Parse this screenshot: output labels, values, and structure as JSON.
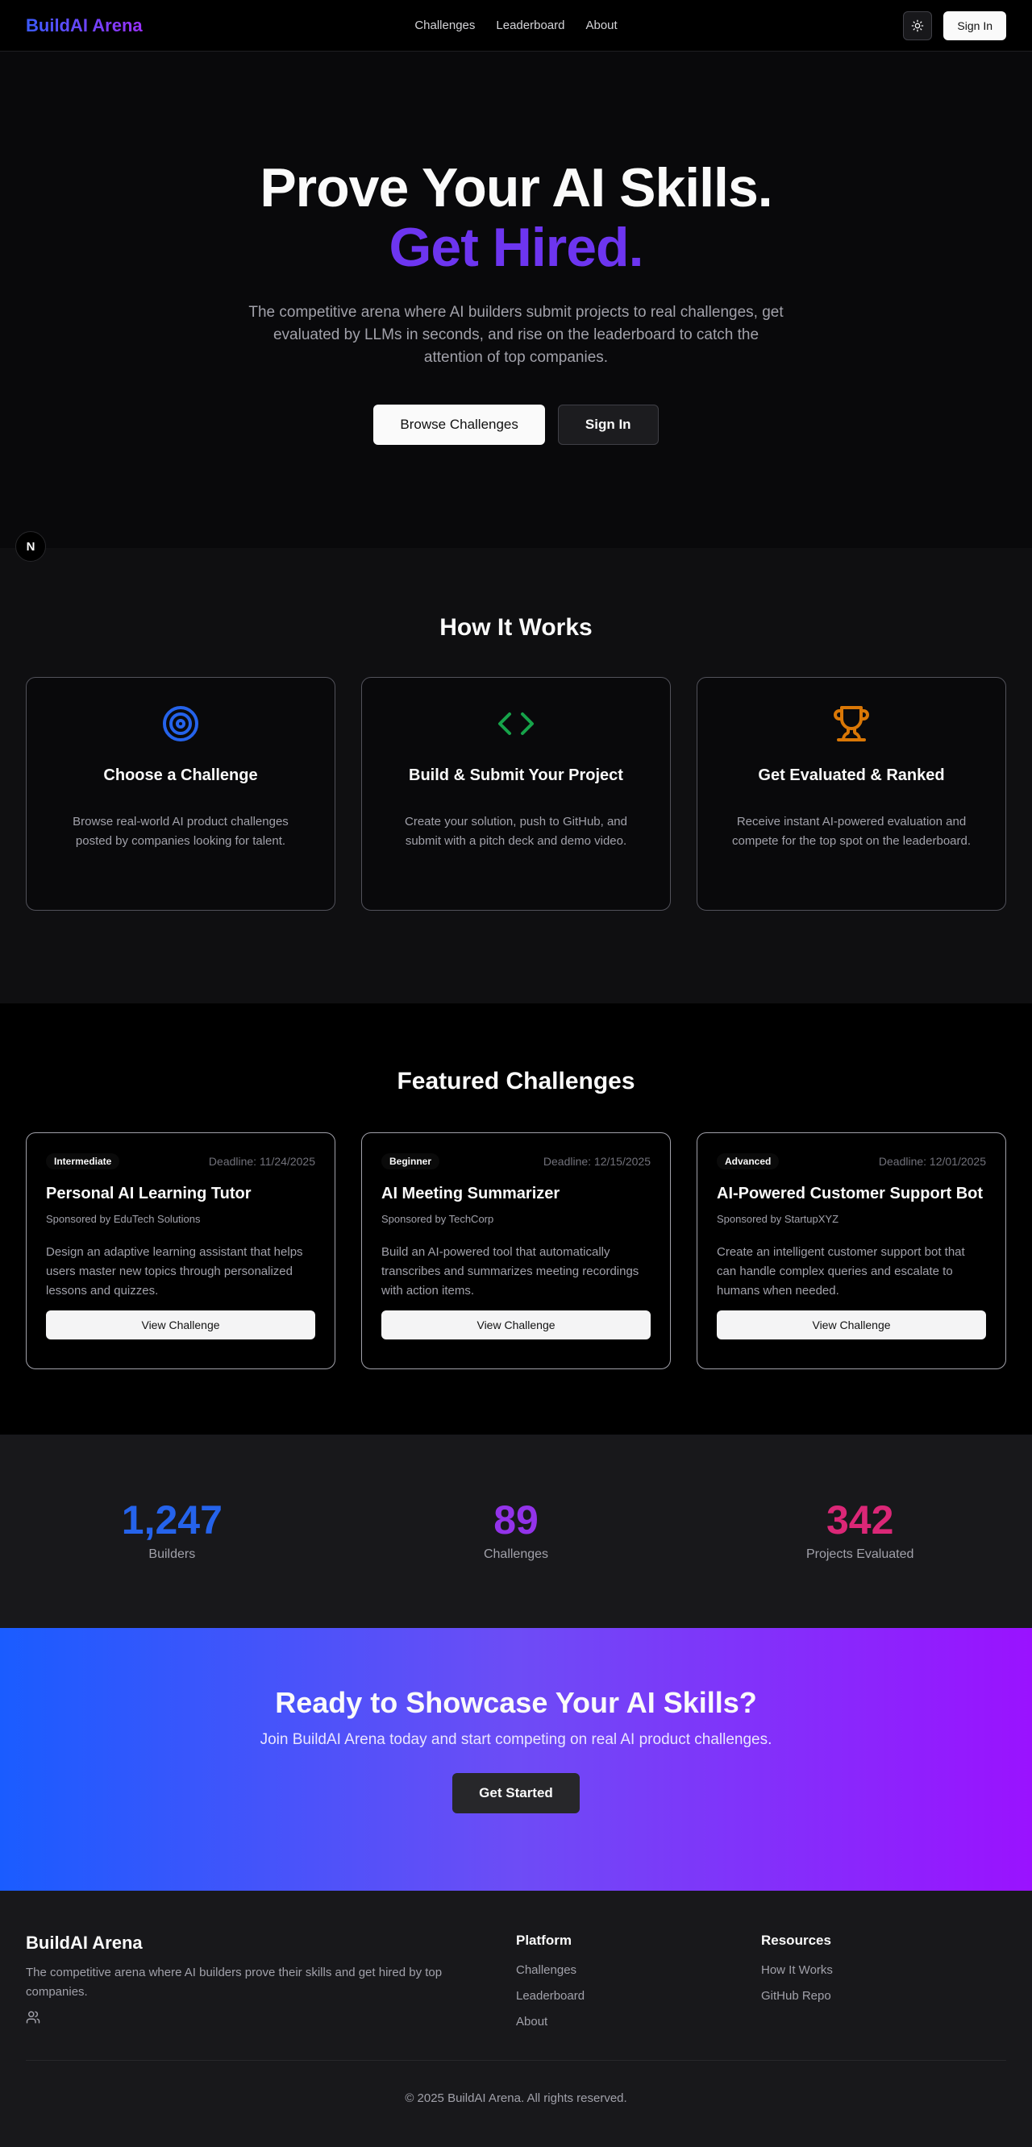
{
  "nav": {
    "logo": "BuildAI Arena",
    "links": [
      "Challenges",
      "Leaderboard",
      "About"
    ],
    "theme_icon": "sun-icon",
    "signin": "Sign In"
  },
  "hero": {
    "title_line1": "Prove Your AI Skills.",
    "title_line2": "Get Hired.",
    "subtitle": "The competitive arena where AI builders submit projects to real challenges, get evaluated by LLMs in seconds, and rise on the leaderboard to catch the attention of top companies.",
    "browse_btn": "Browse Challenges",
    "signin_btn": "Sign In",
    "badge": "N"
  },
  "how": {
    "title": "How It Works",
    "cards": [
      {
        "icon": "target-icon",
        "title": "Choose a Challenge",
        "text": "Browse real-world AI product challenges posted by companies looking for talent.",
        "color": "#2563eb"
      },
      {
        "icon": "code-icon",
        "title": "Build & Submit Your Project",
        "text": "Create your solution, push to GitHub, and submit with a pitch deck and demo video.",
        "color": "#16a34a"
      },
      {
        "icon": "trophy-icon",
        "title": "Get Evaluated & Ranked",
        "text": "Receive instant AI-powered evaluation and compete for the top spot on the leaderboard.",
        "color": "#d97706"
      }
    ]
  },
  "featured": {
    "title": "Featured Challenges",
    "cards": [
      {
        "level": "Intermediate",
        "deadline": "Deadline: 11/24/2025",
        "title": "Personal AI Learning Tutor",
        "sponsor": "Sponsored by EduTech Solutions",
        "desc": "Design an adaptive learning assistant that helps users master new topics through personalized lessons and quizzes.",
        "button": "View Challenge"
      },
      {
        "level": "Beginner",
        "deadline": "Deadline: 12/15/2025",
        "title": "AI Meeting Summarizer",
        "sponsor": "Sponsored by TechCorp",
        "desc": "Build an AI-powered tool that automatically transcribes and summarizes meeting recordings with action items.",
        "button": "View Challenge"
      },
      {
        "level": "Advanced",
        "deadline": "Deadline: 12/01/2025",
        "title": "AI-Powered Customer Support Bot",
        "sponsor": "Sponsored by StartupXYZ",
        "desc": "Create an intelligent customer support bot that can handle complex queries and escalate to humans when needed.",
        "button": "View Challenge"
      }
    ]
  },
  "stats": [
    {
      "value": "1,247",
      "label": "Builders",
      "color": "#2563eb"
    },
    {
      "value": "89",
      "label": "Challenges",
      "color": "#9333ea"
    },
    {
      "value": "342",
      "label": "Projects Evaluated",
      "color": "#db2777"
    }
  ],
  "cta": {
    "title": "Ready to Showcase Your AI Skills?",
    "text": "Join BuildAI Arena today and start competing on real AI product challenges.",
    "button": "Get Started"
  },
  "footer": {
    "brand": "BuildAI Arena",
    "tagline": "The competitive arena where AI builders prove their skills and get hired by top companies.",
    "platform_title": "Platform",
    "platform_links": [
      "Challenges",
      "Leaderboard",
      "About"
    ],
    "resources_title": "Resources",
    "resources_links": [
      "How It Works",
      "GitHub Repo"
    ],
    "copyright": "© 2025 BuildAI Arena. All rights reserved."
  }
}
